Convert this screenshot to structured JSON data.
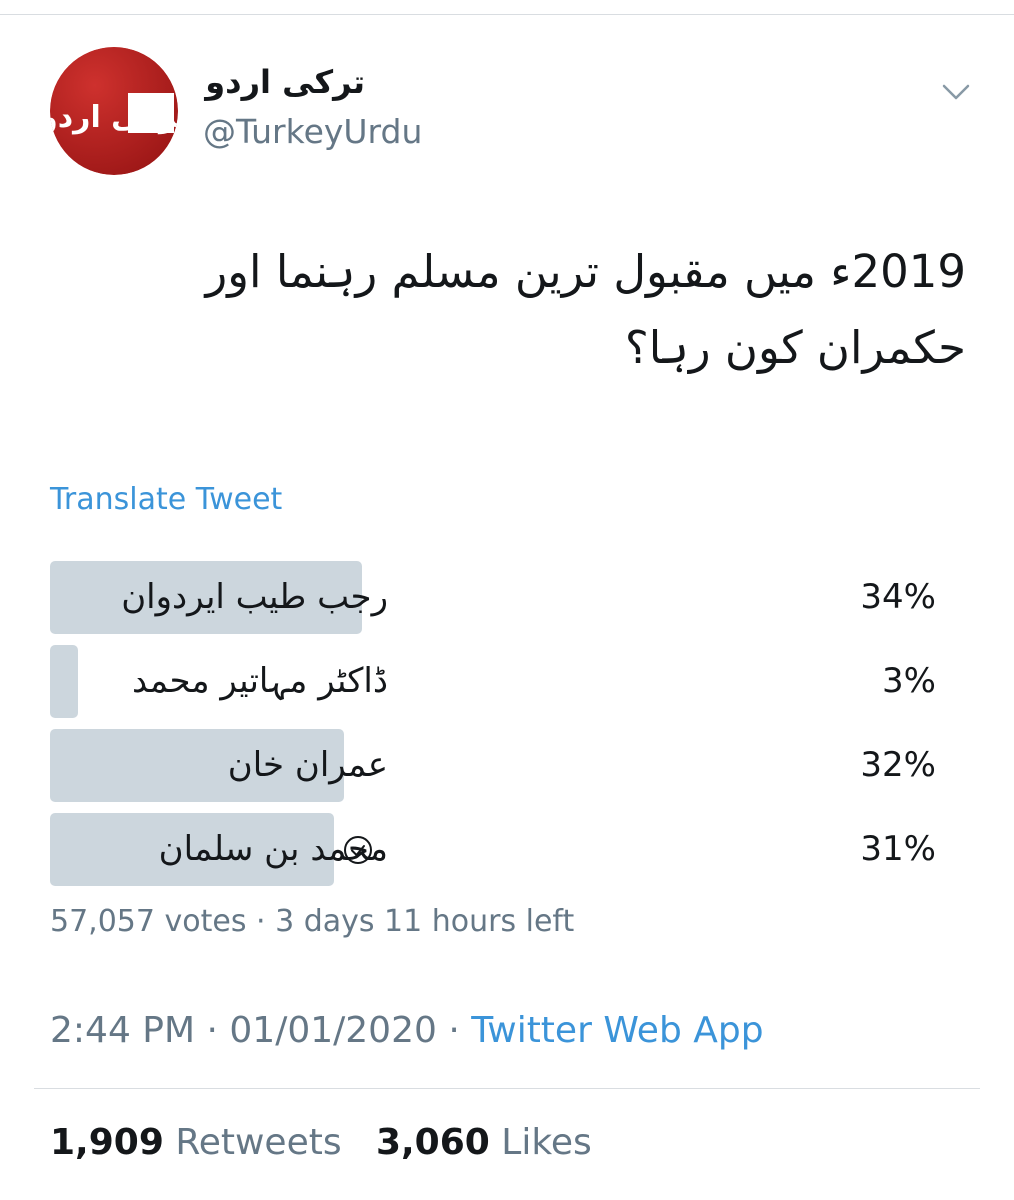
{
  "account": {
    "display_name": "ترکی اردو",
    "handle": "@TurkeyUrdu",
    "avatar_logo_text": "ترکی اردو"
  },
  "tweet": {
    "text": "2019ء میں مقبول ترین مسلم رہنما اور حکمران کون رہا؟",
    "translate_label": "Translate Tweet"
  },
  "poll": {
    "options": [
      {
        "label": "رجب طیب ایردوان",
        "percent_label": "34%",
        "percent": 34,
        "winner": false
      },
      {
        "label": "ڈاکٹر مہاتیر محمد",
        "percent_label": "3%",
        "percent": 3,
        "winner": false
      },
      {
        "label": "عمران خان",
        "percent_label": "32%",
        "percent": 32,
        "winner": false
      },
      {
        "label": "محمد بن سلمان",
        "percent_label": "31%",
        "percent": 31,
        "winner": true
      }
    ],
    "meta": "57,057 votes · 3 days 11 hours left"
  },
  "timestamp": {
    "time_date": "2:44 PM · 01/01/2020 · ",
    "source": "Twitter Web App"
  },
  "stats": {
    "retweets_count": "1,909",
    "retweets_label": "Retweets",
    "likes_count": "3,060",
    "likes_label": "Likes"
  },
  "colors": {
    "link": "#3b94d9",
    "secondary_text": "#657786",
    "poll_bar": "#ccd6dd",
    "avatar_red": "#c8201f"
  },
  "icons": {
    "caret": "chevron-down-icon",
    "winner": "check-circle-icon"
  }
}
